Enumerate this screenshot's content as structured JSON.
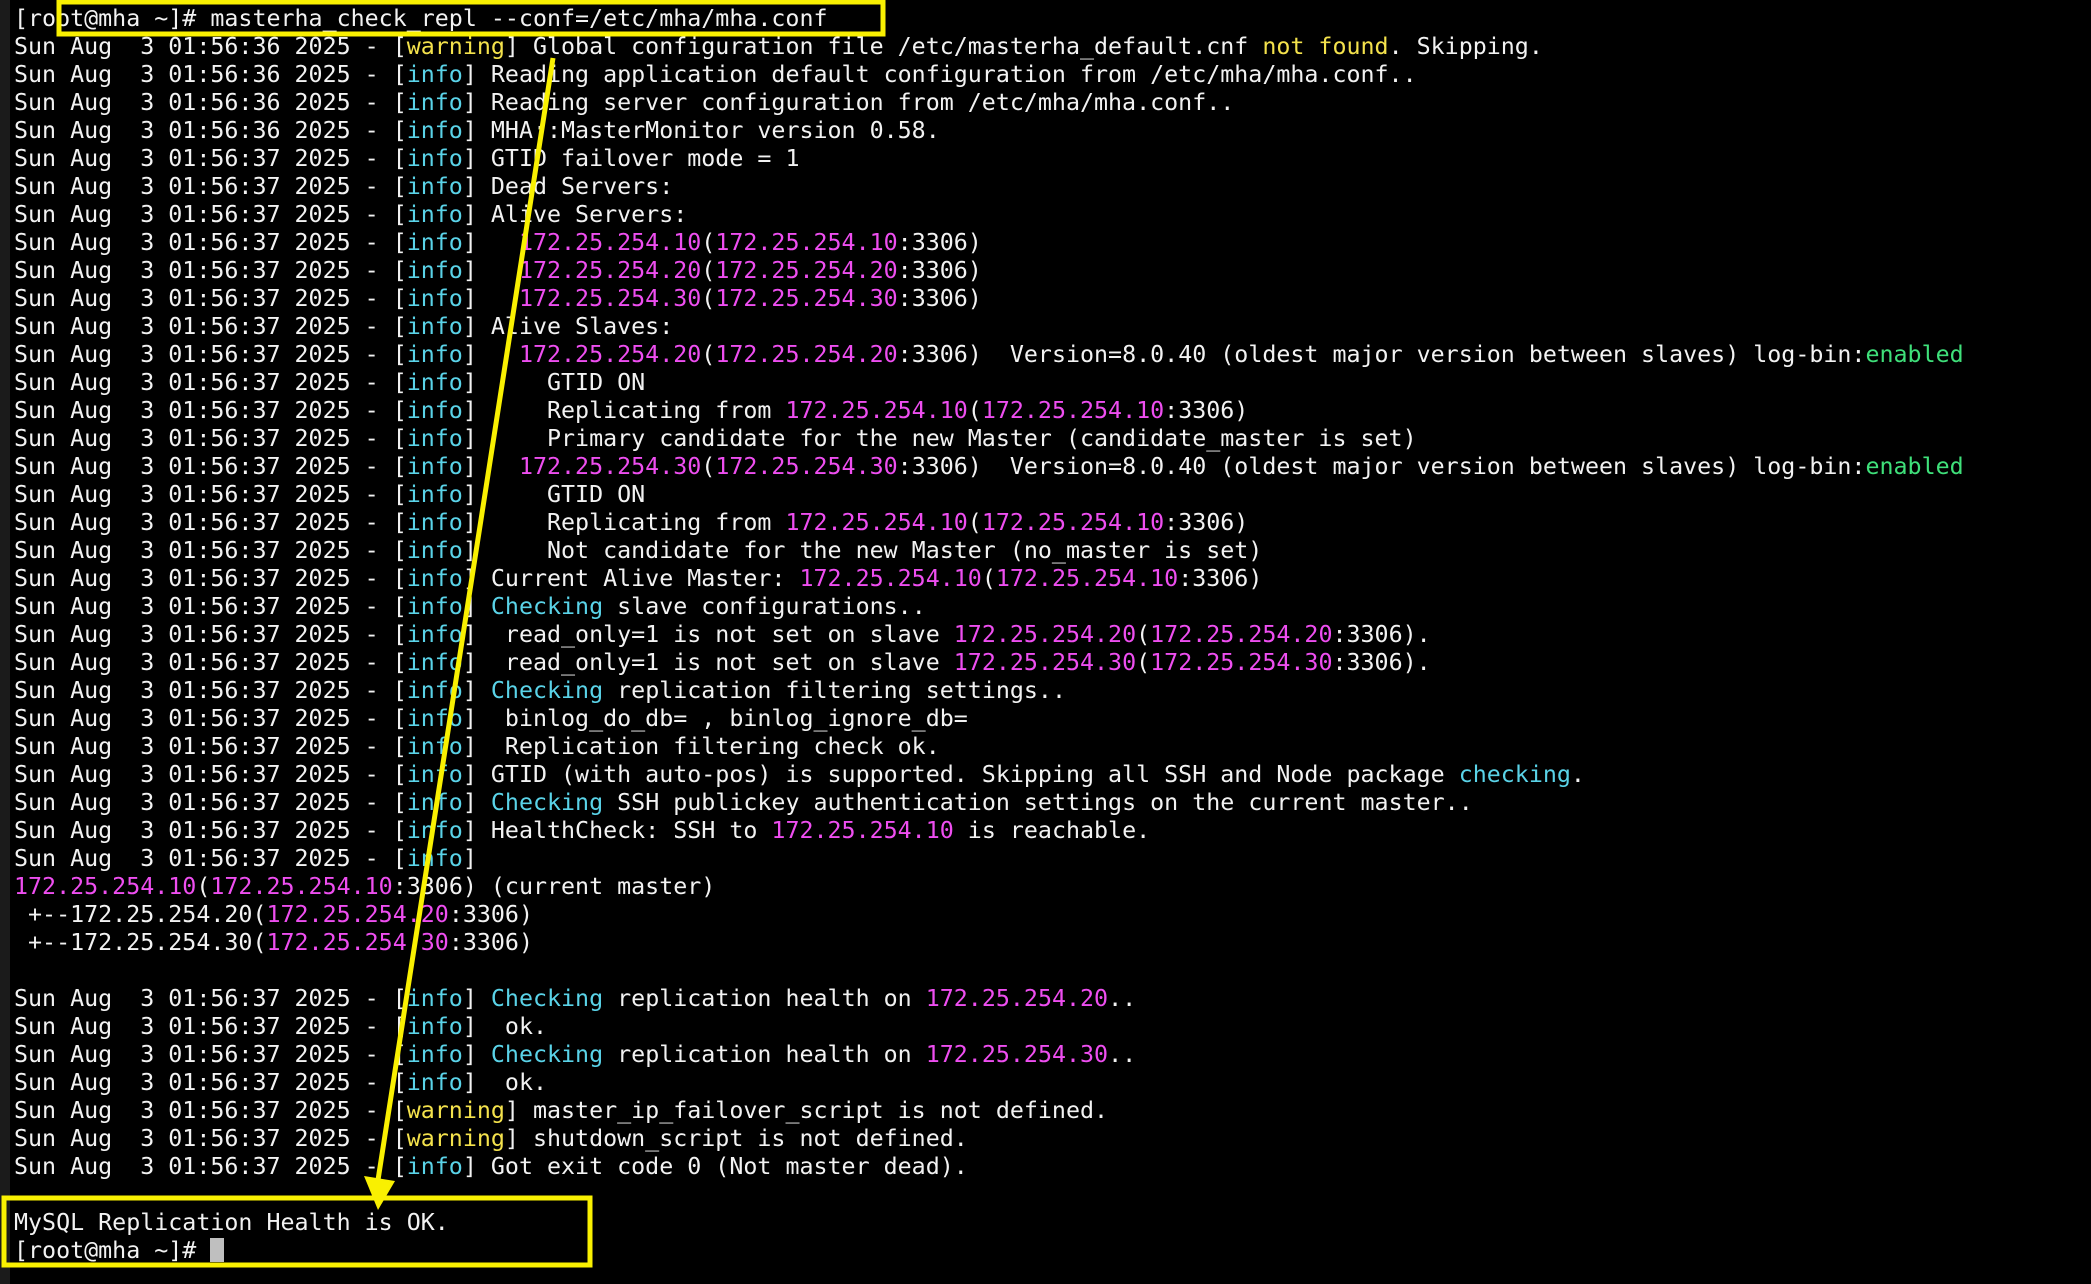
{
  "terminal": {
    "lines": [
      [
        {
          "t": "[root@mha ~]# masterha_check_repl --conf=/etc/mha/mha.conf",
          "c": "default"
        }
      ],
      [
        {
          "t": "Sun Aug  3 01:56:36 2025 - [",
          "c": "default"
        },
        {
          "t": "warning",
          "c": "yellow"
        },
        {
          "t": "] Global configuration file /etc/masterha_default.cnf ",
          "c": "default"
        },
        {
          "t": "not found",
          "c": "yellow"
        },
        {
          "t": ". Skipping.",
          "c": "default"
        }
      ],
      [
        {
          "t": "Sun Aug  3 01:56:36 2025 - [",
          "c": "default"
        },
        {
          "t": "info",
          "c": "cyan"
        },
        {
          "t": "] Reading application default configuration from /etc/mha/mha.conf..",
          "c": "default"
        }
      ],
      [
        {
          "t": "Sun Aug  3 01:56:36 2025 - [",
          "c": "default"
        },
        {
          "t": "info",
          "c": "cyan"
        },
        {
          "t": "] Reading server configuration from /etc/mha/mha.conf..",
          "c": "default"
        }
      ],
      [
        {
          "t": "Sun Aug  3 01:56:36 2025 - [",
          "c": "default"
        },
        {
          "t": "info",
          "c": "cyan"
        },
        {
          "t": "] MHA::MasterMonitor version 0.58.",
          "c": "default"
        }
      ],
      [
        {
          "t": "Sun Aug  3 01:56:37 2025 - [",
          "c": "default"
        },
        {
          "t": "info",
          "c": "cyan"
        },
        {
          "t": "] GTID failover mode = 1",
          "c": "default"
        }
      ],
      [
        {
          "t": "Sun Aug  3 01:56:37 2025 - [",
          "c": "default"
        },
        {
          "t": "info",
          "c": "cyan"
        },
        {
          "t": "] Dead Servers:",
          "c": "default"
        }
      ],
      [
        {
          "t": "Sun Aug  3 01:56:37 2025 - [",
          "c": "default"
        },
        {
          "t": "info",
          "c": "cyan"
        },
        {
          "t": "] Alive Servers:",
          "c": "default"
        }
      ],
      [
        {
          "t": "Sun Aug  3 01:56:37 2025 - [",
          "c": "default"
        },
        {
          "t": "info",
          "c": "cyan"
        },
        {
          "t": "]   ",
          "c": "default"
        },
        {
          "t": "172.25.254.10",
          "c": "magenta"
        },
        {
          "t": "(",
          "c": "default"
        },
        {
          "t": "172.25.254.10",
          "c": "magenta"
        },
        {
          "t": ":3306)",
          "c": "default"
        }
      ],
      [
        {
          "t": "Sun Aug  3 01:56:37 2025 - [",
          "c": "default"
        },
        {
          "t": "info",
          "c": "cyan"
        },
        {
          "t": "]   ",
          "c": "default"
        },
        {
          "t": "172.25.254.20",
          "c": "magenta"
        },
        {
          "t": "(",
          "c": "default"
        },
        {
          "t": "172.25.254.20",
          "c": "magenta"
        },
        {
          "t": ":3306)",
          "c": "default"
        }
      ],
      [
        {
          "t": "Sun Aug  3 01:56:37 2025 - [",
          "c": "default"
        },
        {
          "t": "info",
          "c": "cyan"
        },
        {
          "t": "]   ",
          "c": "default"
        },
        {
          "t": "172.25.254.30",
          "c": "magenta"
        },
        {
          "t": "(",
          "c": "default"
        },
        {
          "t": "172.25.254.30",
          "c": "magenta"
        },
        {
          "t": ":3306)",
          "c": "default"
        }
      ],
      [
        {
          "t": "Sun Aug  3 01:56:37 2025 - [",
          "c": "default"
        },
        {
          "t": "info",
          "c": "cyan"
        },
        {
          "t": "] Alive Slaves:",
          "c": "default"
        }
      ],
      [
        {
          "t": "Sun Aug  3 01:56:37 2025 - [",
          "c": "default"
        },
        {
          "t": "info",
          "c": "cyan"
        },
        {
          "t": "]   ",
          "c": "default"
        },
        {
          "t": "172.25.254.20",
          "c": "magenta"
        },
        {
          "t": "(",
          "c": "default"
        },
        {
          "t": "172.25.254.20",
          "c": "magenta"
        },
        {
          "t": ":3306)  Version=8.0.40 (oldest major version between slaves) log-bin:",
          "c": "default"
        },
        {
          "t": "enabled",
          "c": "green"
        }
      ],
      [
        {
          "t": "Sun Aug  3 01:56:37 2025 - [",
          "c": "default"
        },
        {
          "t": "info",
          "c": "cyan"
        },
        {
          "t": "]     GTID ON",
          "c": "default"
        }
      ],
      [
        {
          "t": "Sun Aug  3 01:56:37 2025 - [",
          "c": "default"
        },
        {
          "t": "info",
          "c": "cyan"
        },
        {
          "t": "]     Replicating from ",
          "c": "default"
        },
        {
          "t": "172.25.254.10",
          "c": "magenta"
        },
        {
          "t": "(",
          "c": "default"
        },
        {
          "t": "172.25.254.10",
          "c": "magenta"
        },
        {
          "t": ":3306)",
          "c": "default"
        }
      ],
      [
        {
          "t": "Sun Aug  3 01:56:37 2025 - [",
          "c": "default"
        },
        {
          "t": "info",
          "c": "cyan"
        },
        {
          "t": "]     Primary candidate for the new Master (candidate_master is set)",
          "c": "default"
        }
      ],
      [
        {
          "t": "Sun Aug  3 01:56:37 2025 - [",
          "c": "default"
        },
        {
          "t": "info",
          "c": "cyan"
        },
        {
          "t": "]   ",
          "c": "default"
        },
        {
          "t": "172.25.254.30",
          "c": "magenta"
        },
        {
          "t": "(",
          "c": "default"
        },
        {
          "t": "172.25.254.30",
          "c": "magenta"
        },
        {
          "t": ":3306)  Version=8.0.40 (oldest major version between slaves) log-bin:",
          "c": "default"
        },
        {
          "t": "enabled",
          "c": "green"
        }
      ],
      [
        {
          "t": "Sun Aug  3 01:56:37 2025 - [",
          "c": "default"
        },
        {
          "t": "info",
          "c": "cyan"
        },
        {
          "t": "]     GTID ON",
          "c": "default"
        }
      ],
      [
        {
          "t": "Sun Aug  3 01:56:37 2025 - [",
          "c": "default"
        },
        {
          "t": "info",
          "c": "cyan"
        },
        {
          "t": "]     Replicating from ",
          "c": "default"
        },
        {
          "t": "172.25.254.10",
          "c": "magenta"
        },
        {
          "t": "(",
          "c": "default"
        },
        {
          "t": "172.25.254.10",
          "c": "magenta"
        },
        {
          "t": ":3306)",
          "c": "default"
        }
      ],
      [
        {
          "t": "Sun Aug  3 01:56:37 2025 - [",
          "c": "default"
        },
        {
          "t": "info",
          "c": "cyan"
        },
        {
          "t": "]     Not candidate for the new Master (no_master is set)",
          "c": "default"
        }
      ],
      [
        {
          "t": "Sun Aug  3 01:56:37 2025 - [",
          "c": "default"
        },
        {
          "t": "info",
          "c": "cyan"
        },
        {
          "t": "] Current Alive Master: ",
          "c": "default"
        },
        {
          "t": "172.25.254.10",
          "c": "magenta"
        },
        {
          "t": "(",
          "c": "default"
        },
        {
          "t": "172.25.254.10",
          "c": "magenta"
        },
        {
          "t": ":3306)",
          "c": "default"
        }
      ],
      [
        {
          "t": "Sun Aug  3 01:56:37 2025 - [",
          "c": "default"
        },
        {
          "t": "info",
          "c": "cyan"
        },
        {
          "t": "] ",
          "c": "default"
        },
        {
          "t": "Checking",
          "c": "cyan"
        },
        {
          "t": " slave configurations..",
          "c": "default"
        }
      ],
      [
        {
          "t": "Sun Aug  3 01:56:37 2025 - [",
          "c": "default"
        },
        {
          "t": "info",
          "c": "cyan"
        },
        {
          "t": "]  read_only=1 is not set on slave ",
          "c": "default"
        },
        {
          "t": "172.25.254.20",
          "c": "magenta"
        },
        {
          "t": "(",
          "c": "default"
        },
        {
          "t": "172.25.254.20",
          "c": "magenta"
        },
        {
          "t": ":3306).",
          "c": "default"
        }
      ],
      [
        {
          "t": "Sun Aug  3 01:56:37 2025 - [",
          "c": "default"
        },
        {
          "t": "info",
          "c": "cyan"
        },
        {
          "t": "]  read_only=1 is not set on slave ",
          "c": "default"
        },
        {
          "t": "172.25.254.30",
          "c": "magenta"
        },
        {
          "t": "(",
          "c": "default"
        },
        {
          "t": "172.25.254.30",
          "c": "magenta"
        },
        {
          "t": ":3306).",
          "c": "default"
        }
      ],
      [
        {
          "t": "Sun Aug  3 01:56:37 2025 - [",
          "c": "default"
        },
        {
          "t": "info",
          "c": "cyan"
        },
        {
          "t": "] ",
          "c": "default"
        },
        {
          "t": "Checking",
          "c": "cyan"
        },
        {
          "t": " replication filtering settings..",
          "c": "default"
        }
      ],
      [
        {
          "t": "Sun Aug  3 01:56:37 2025 - [",
          "c": "default"
        },
        {
          "t": "info",
          "c": "cyan"
        },
        {
          "t": "]  binlog_do_db= , binlog_ignore_db=",
          "c": "default"
        }
      ],
      [
        {
          "t": "Sun Aug  3 01:56:37 2025 - [",
          "c": "default"
        },
        {
          "t": "info",
          "c": "cyan"
        },
        {
          "t": "]  Replication filtering check ok.",
          "c": "default"
        }
      ],
      [
        {
          "t": "Sun Aug  3 01:56:37 2025 - [",
          "c": "default"
        },
        {
          "t": "info",
          "c": "cyan"
        },
        {
          "t": "] GTID (with auto-pos) is supported. Skipping all SSH and Node package ",
          "c": "default"
        },
        {
          "t": "checking",
          "c": "cyan"
        },
        {
          "t": ".",
          "c": "default"
        }
      ],
      [
        {
          "t": "Sun Aug  3 01:56:37 2025 - [",
          "c": "default"
        },
        {
          "t": "info",
          "c": "cyan"
        },
        {
          "t": "] ",
          "c": "default"
        },
        {
          "t": "Checking",
          "c": "cyan"
        },
        {
          "t": " SSH publickey authentication settings on the current master..",
          "c": "default"
        }
      ],
      [
        {
          "t": "Sun Aug  3 01:56:37 2025 - [",
          "c": "default"
        },
        {
          "t": "info",
          "c": "cyan"
        },
        {
          "t": "] HealthCheck: SSH to ",
          "c": "default"
        },
        {
          "t": "172.25.254.10",
          "c": "magenta"
        },
        {
          "t": " is reachable.",
          "c": "default"
        }
      ],
      [
        {
          "t": "Sun Aug  3 01:56:37 2025 - [",
          "c": "default"
        },
        {
          "t": "info",
          "c": "cyan"
        },
        {
          "t": "]",
          "c": "default"
        }
      ],
      [
        {
          "t": "172.25.254.10",
          "c": "magenta"
        },
        {
          "t": "(",
          "c": "default"
        },
        {
          "t": "172.25.254.10",
          "c": "magenta"
        },
        {
          "t": ":3306) (current master)",
          "c": "default"
        }
      ],
      [
        {
          "t": " +--172.25.254.20(",
          "c": "default"
        },
        {
          "t": "172.25.254.20",
          "c": "magenta"
        },
        {
          "t": ":3306)",
          "c": "default"
        }
      ],
      [
        {
          "t": " +--172.25.254.30(",
          "c": "default"
        },
        {
          "t": "172.25.254.30",
          "c": "magenta"
        },
        {
          "t": ":3306)",
          "c": "default"
        }
      ],
      [
        {
          "t": "",
          "c": "default"
        }
      ],
      [
        {
          "t": "Sun Aug  3 01:56:37 2025 - [",
          "c": "default"
        },
        {
          "t": "info",
          "c": "cyan"
        },
        {
          "t": "] ",
          "c": "default"
        },
        {
          "t": "Checking",
          "c": "cyan"
        },
        {
          "t": " replication health on ",
          "c": "default"
        },
        {
          "t": "172.25.254.20",
          "c": "magenta"
        },
        {
          "t": "..",
          "c": "default"
        }
      ],
      [
        {
          "t": "Sun Aug  3 01:56:37 2025 - [",
          "c": "default"
        },
        {
          "t": "info",
          "c": "cyan"
        },
        {
          "t": "]  ok.",
          "c": "default"
        }
      ],
      [
        {
          "t": "Sun Aug  3 01:56:37 2025 - [",
          "c": "default"
        },
        {
          "t": "info",
          "c": "cyan"
        },
        {
          "t": "] ",
          "c": "default"
        },
        {
          "t": "Checking",
          "c": "cyan"
        },
        {
          "t": " replication health on ",
          "c": "default"
        },
        {
          "t": "172.25.254.30",
          "c": "magenta"
        },
        {
          "t": "..",
          "c": "default"
        }
      ],
      [
        {
          "t": "Sun Aug  3 01:56:37 2025 - [",
          "c": "default"
        },
        {
          "t": "info",
          "c": "cyan"
        },
        {
          "t": "]  ok.",
          "c": "default"
        }
      ],
      [
        {
          "t": "Sun Aug  3 01:56:37 2025 - [",
          "c": "default"
        },
        {
          "t": "warning",
          "c": "yellow"
        },
        {
          "t": "] master_ip_failover_script is not defined.",
          "c": "default"
        }
      ],
      [
        {
          "t": "Sun Aug  3 01:56:37 2025 - [",
          "c": "default"
        },
        {
          "t": "warning",
          "c": "yellow"
        },
        {
          "t": "] shutdown_script is not defined.",
          "c": "default"
        }
      ],
      [
        {
          "t": "Sun Aug  3 01:56:37 2025 - [",
          "c": "default"
        },
        {
          "t": "info",
          "c": "cyan"
        },
        {
          "t": "] Got exit code 0 (Not master dead).",
          "c": "default"
        }
      ],
      [
        {
          "t": "",
          "c": "default"
        }
      ],
      [
        {
          "t": "MySQL Replication Health is OK.",
          "c": "default"
        }
      ]
    ],
    "prompt": "[root@mha ~]# "
  },
  "colors": {
    "background": "#000000",
    "default": "#f2f2f2",
    "yellow": "#f4e24c",
    "cyan": "#5ad3e8",
    "magenta": "#ee4ef0",
    "green": "#3fe07a",
    "annotation": "#f9f001"
  },
  "annotations": {
    "shapes": [
      "highlight-box-command",
      "arrow",
      "highlight-box-result"
    ]
  }
}
